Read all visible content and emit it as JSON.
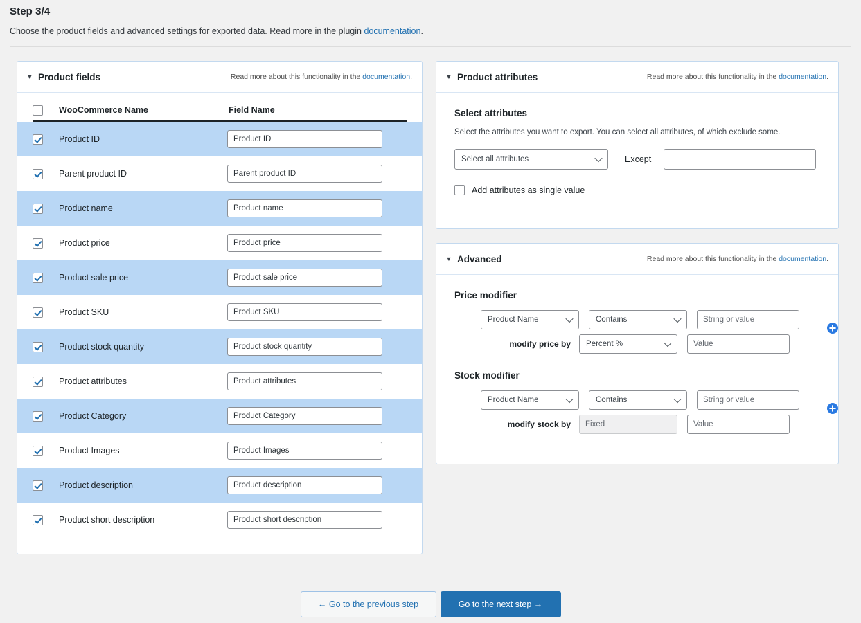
{
  "header": {
    "step_title": "Step 3/4",
    "description_before": "Choose the product fields and advanced settings for exported data. Read more in the plugin ",
    "description_link": "documentation",
    "description_after": "."
  },
  "panel_note": {
    "prefix": "Read more about this functionality in the ",
    "link": "documentation",
    "suffix": "."
  },
  "product_fields": {
    "title": "Product fields",
    "columns": {
      "woocommerce_name": "WooCommerce Name",
      "field_name": "Field Name"
    },
    "select_all_checked": false,
    "rows": [
      {
        "label": "Product ID",
        "value": "Product ID",
        "checked": true,
        "highlight": true
      },
      {
        "label": "Parent product ID",
        "value": "Parent product ID",
        "checked": true,
        "highlight": false
      },
      {
        "label": "Product name",
        "value": "Product name",
        "checked": true,
        "highlight": true
      },
      {
        "label": "Product price",
        "value": "Product price",
        "checked": true,
        "highlight": false
      },
      {
        "label": "Product sale price",
        "value": "Product sale price",
        "checked": true,
        "highlight": true
      },
      {
        "label": "Product SKU",
        "value": "Product SKU",
        "checked": true,
        "highlight": false
      },
      {
        "label": "Product stock quantity",
        "value": "Product stock quantity",
        "checked": true,
        "highlight": true
      },
      {
        "label": "Product attributes",
        "value": "Product attributes",
        "checked": true,
        "highlight": false
      },
      {
        "label": "Product Category",
        "value": "Product Category",
        "checked": true,
        "highlight": true
      },
      {
        "label": "Product Images",
        "value": "Product Images",
        "checked": true,
        "highlight": false
      },
      {
        "label": "Product description",
        "value": "Product description",
        "checked": true,
        "highlight": true
      },
      {
        "label": "Product short description",
        "value": "Product short description",
        "checked": true,
        "highlight": false
      }
    ]
  },
  "product_attributes": {
    "title": "Product attributes",
    "sub_title": "Select attributes",
    "description": "Select the attributes you want to export. You can select all attributes, of which exclude some.",
    "select_value": "Select all attributes",
    "except_label": "Except",
    "except_value": "",
    "single_value_label": "Add attributes as single value",
    "single_value_checked": false
  },
  "advanced": {
    "title": "Advanced",
    "price_modifier": {
      "title": "Price modifier",
      "field_select": "Product Name",
      "operator_select": "Contains",
      "string_placeholder": "String or value",
      "string_value": "",
      "modify_label": "modify price by",
      "modify_type": "Percent %",
      "modify_type_disabled": false,
      "value_placeholder": "Value",
      "value_value": ""
    },
    "stock_modifier": {
      "title": "Stock modifier",
      "field_select": "Product Name",
      "operator_select": "Contains",
      "string_placeholder": "String or value",
      "string_value": "",
      "modify_label": "modify stock by",
      "modify_type": "Fixed",
      "modify_type_disabled": true,
      "value_placeholder": "Value",
      "value_value": ""
    }
  },
  "footer": {
    "previous_label": "← Go to the previous step",
    "next_label": "Go to the next step →"
  },
  "colors": {
    "accent": "#2271b1",
    "row_highlight": "#b9d7f5",
    "page_background": "#f1f1f1",
    "panel_border": "#c3d9ef",
    "plus_icon": "#2a7ae2"
  }
}
